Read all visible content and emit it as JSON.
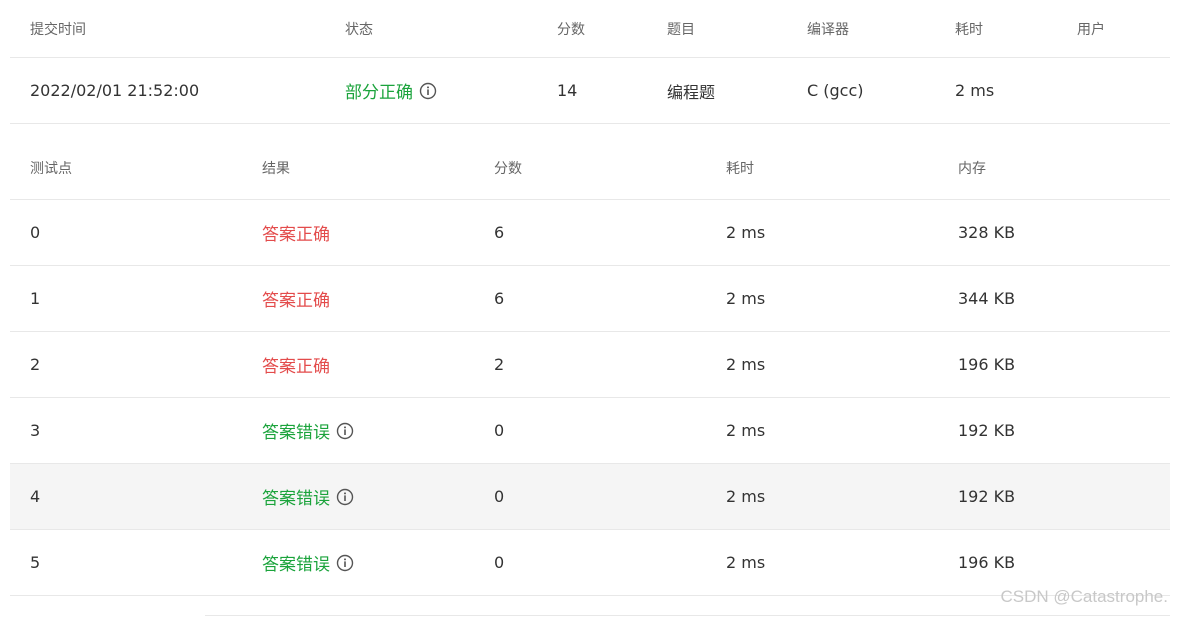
{
  "submission": {
    "headers": [
      "提交时间",
      "状态",
      "分数",
      "题目",
      "编译器",
      "耗时",
      "用户"
    ],
    "time": "2022/02/01 21:52:00",
    "status": "部分正确",
    "score": "14",
    "problem": "编程题",
    "compiler": "C (gcc)",
    "duration": "2 ms",
    "user": ""
  },
  "testcases": {
    "headers": [
      "测试点",
      "结果",
      "分数",
      "耗时",
      "内存"
    ],
    "rows": [
      {
        "id": "0",
        "result": "答案正确",
        "score": "6",
        "time": "2 ms",
        "memory": "328 KB"
      },
      {
        "id": "1",
        "result": "答案正确",
        "score": "6",
        "time": "2 ms",
        "memory": "344 KB"
      },
      {
        "id": "2",
        "result": "答案正确",
        "score": "2",
        "time": "2 ms",
        "memory": "196 KB"
      },
      {
        "id": "3",
        "result": "答案错误",
        "score": "0",
        "time": "2 ms",
        "memory": "192 KB"
      },
      {
        "id": "4",
        "result": "答案错误",
        "score": "0",
        "time": "2 ms",
        "memory": "192 KB"
      },
      {
        "id": "5",
        "result": "答案错误",
        "score": "0",
        "time": "2 ms",
        "memory": "196 KB"
      }
    ]
  },
  "watermark": "CSDN @Catastrophe.",
  "colors": {
    "correct": "#e34b4b",
    "wrong": "#1aa33b",
    "partial": "#1aa33b"
  },
  "icons": {
    "info": "info-circle-icon"
  }
}
